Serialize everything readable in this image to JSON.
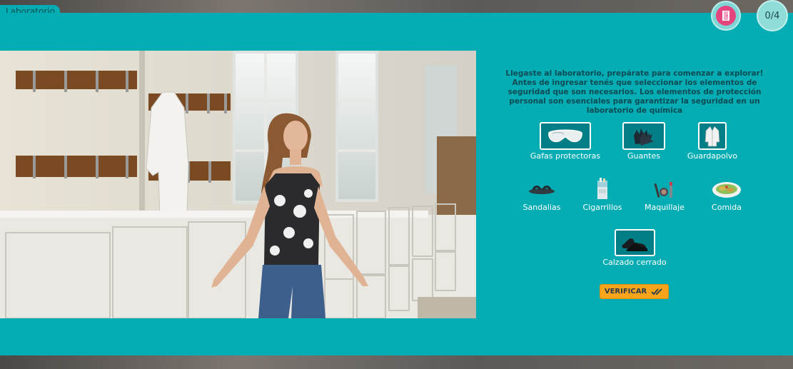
{
  "header": {
    "tab_label": "Laboratorio",
    "exit_icon": "door-exit-icon",
    "progress": "0/4"
  },
  "intro_text": "Llegaste al laboratorio, prepárate para comenzar a explorar! Antes de ingresar tenés que seleccionar los elementos de seguridad que son necesarios. Los elementos de protección personal son esenciales para garantizar la seguridad en un laboratorio de química",
  "items": [
    {
      "label": "Gafas protectoras",
      "icon": "safety-goggles-icon",
      "boxed": true
    },
    {
      "label": "Guantes",
      "icon": "gloves-icon",
      "boxed": true
    },
    {
      "label": "Guardapolvo",
      "icon": "lab-coat-icon",
      "boxed": true
    },
    {
      "label": "Sandalias",
      "icon": "sandals-icon",
      "boxed": false
    },
    {
      "label": "Cigarrillos",
      "icon": "cigarettes-icon",
      "boxed": false
    },
    {
      "label": "Maquillaje",
      "icon": "makeup-icon",
      "boxed": false
    },
    {
      "label": "Comida",
      "icon": "food-icon",
      "boxed": false
    },
    {
      "label": "Calzado cerrado",
      "icon": "closed-shoes-icon",
      "boxed": true
    }
  ],
  "verify_button": {
    "label": "VERIFICAR",
    "icon": "double-check-icon"
  },
  "video": {
    "description_icon": "video-frame"
  },
  "colors": {
    "panel": "#03adb3",
    "accent": "#f8a51b",
    "exit": "#e5457f"
  }
}
